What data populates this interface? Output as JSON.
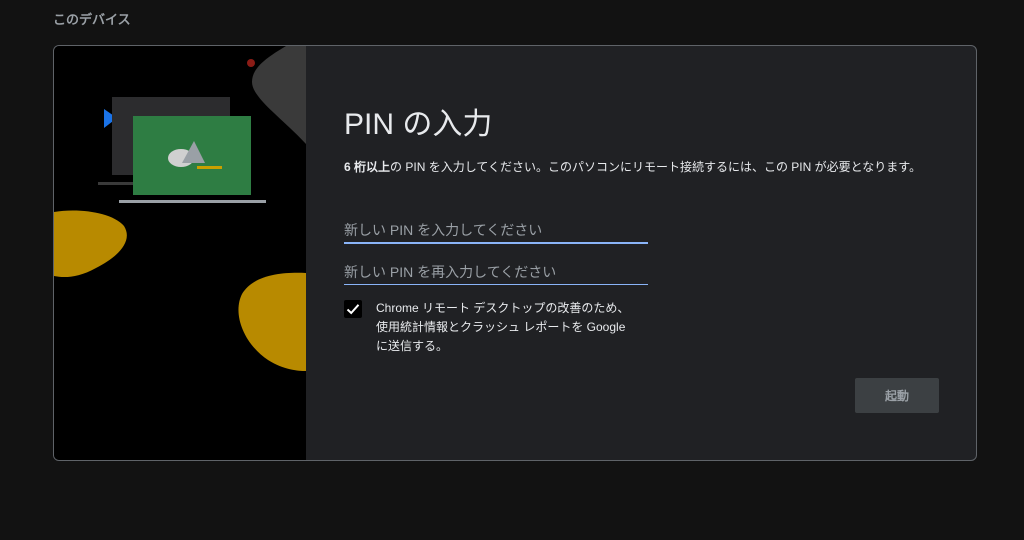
{
  "section": {
    "title": "このデバイス"
  },
  "dialog": {
    "heading": "PIN の入力",
    "description_bold": "6 桁以上",
    "description_rest": "の PIN を入力してください。このパソコンにリモート接続するには、この PIN が必要となります。",
    "pin_field": {
      "placeholder": "新しい PIN を入力してください",
      "value": ""
    },
    "pin_confirm_field": {
      "placeholder": "新しい PIN を再入力してください",
      "value": ""
    },
    "usage_stats": {
      "checked": true,
      "label": "Chrome リモート デスクトップの改善のため、使用統計情報とクラッシュ レポートを Google に送信する。"
    },
    "start_button": {
      "label": "起動",
      "enabled": false
    }
  },
  "colors": {
    "background": "#121212",
    "dialog": "#202124",
    "accent": "#8ab4f8",
    "illustration_green": "#2e7d43",
    "illustration_gold": "#b88a00",
    "illustration_blue": "#1a73e8",
    "illustration_red": "#8b1c16"
  },
  "icons": [
    "checkmark-icon",
    "play-triangle-icon",
    "monitor-illustration"
  ]
}
